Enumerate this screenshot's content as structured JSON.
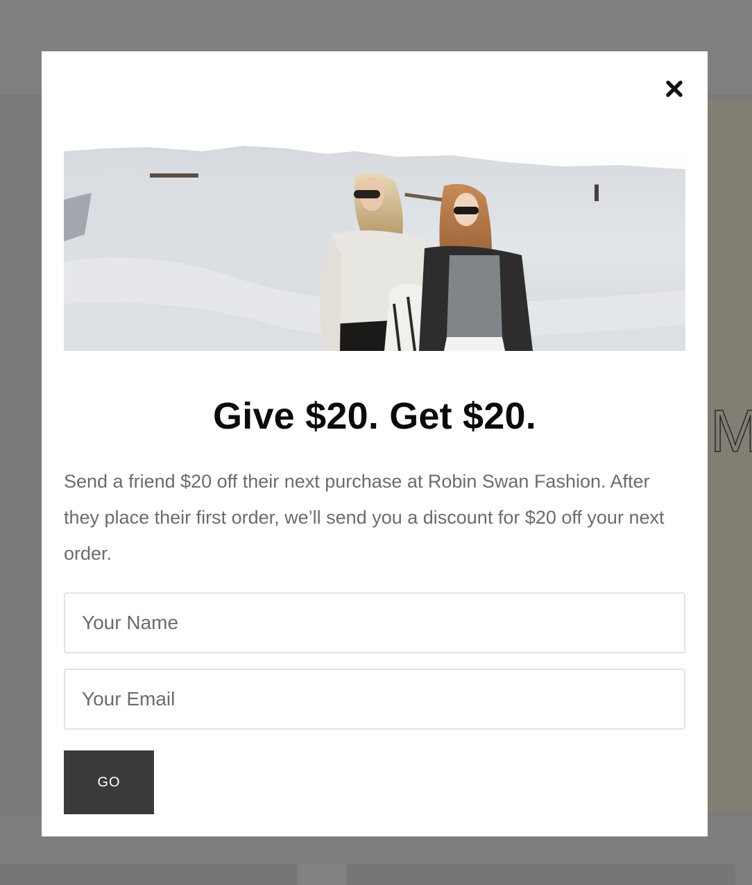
{
  "background": {
    "hero_letter": "M"
  },
  "modal": {
    "close_icon": "close-icon",
    "image_alt": "hero-photo",
    "headline": "Give $20. Get $20.",
    "body": "Send a friend $20 off their next purchase at Robin Swan Fashion. After they place their first order, we’ll send you a discount for $20 off your next order.",
    "name_placeholder": "Your Name",
    "email_placeholder": "Your Email",
    "submit_label": "GO"
  },
  "colors": {
    "overlay": "#7d7d7d",
    "modal_bg": "#ffffff",
    "headline": "#0b0b0b",
    "body_text": "#6b6b6b",
    "button_bg": "#3a3a3a",
    "button_text": "#ffffff"
  }
}
